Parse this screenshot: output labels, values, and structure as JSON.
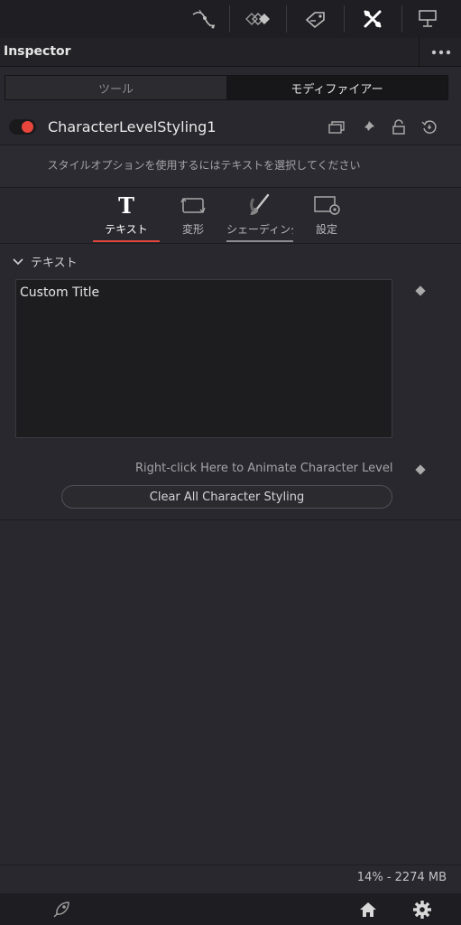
{
  "panel": {
    "title": "Inspector"
  },
  "segments": {
    "tools": "ツール",
    "modifiers": "モディファイアー"
  },
  "node": {
    "name": "CharacterLevelStyling1",
    "enabled": true
  },
  "hint": "スタイルオプションを使用するにはテキストを選択してください",
  "tabs": [
    {
      "label": "テキスト",
      "icon": "text-T-icon",
      "active": true
    },
    {
      "label": "変形",
      "icon": "transform-icon"
    },
    {
      "label": "シェーディング",
      "icon": "shading-brush-icon"
    },
    {
      "label": "設定",
      "icon": "settings-gear-icon"
    }
  ],
  "text_section": {
    "title": "テキスト",
    "value": "Custom Title",
    "animate_label": "Right-click Here to Animate Character Levels",
    "clear_button": "Clear All Character Styling"
  },
  "status": "14% - 2274 MB",
  "colors": {
    "accent_red": "#e0463c",
    "background": "#28282e",
    "toolbar": "#1f1f23"
  }
}
